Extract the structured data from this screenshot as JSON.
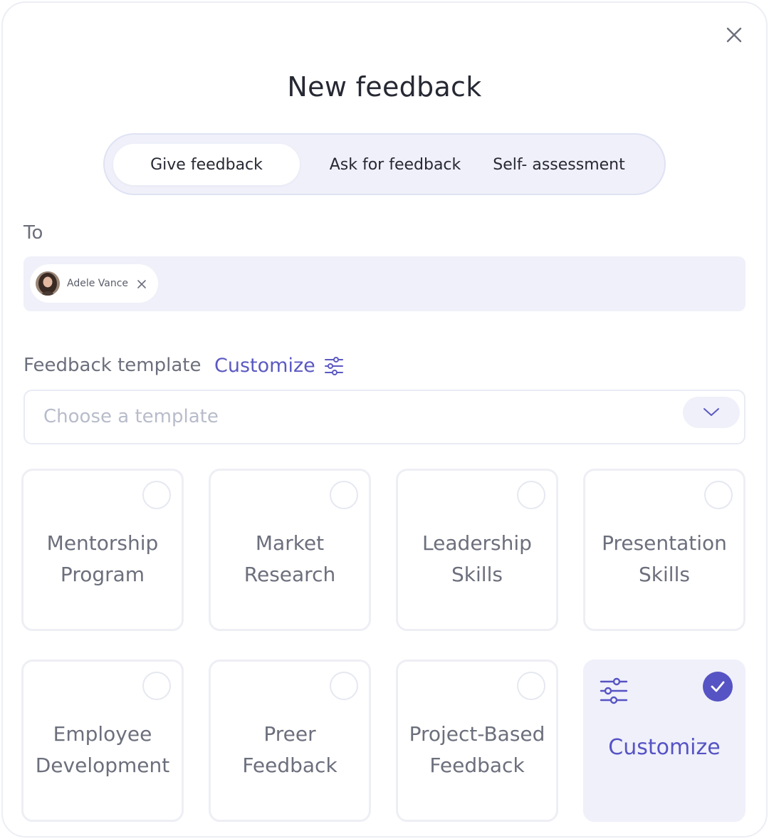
{
  "dialog": {
    "title": "New feedback",
    "close_icon": "close-icon"
  },
  "tabs": [
    {
      "label": "Give feedback",
      "active": true
    },
    {
      "label": "Ask for feedback",
      "active": false
    },
    {
      "label": "Self- assessment",
      "active": false
    }
  ],
  "to_section": {
    "label": "To",
    "recipient": {
      "name": "Adele Vance",
      "avatar_icon": "avatar",
      "remove_icon": "close-icon"
    }
  },
  "template_section": {
    "label": "Feedback template",
    "customize_label": "Customize",
    "customize_icon": "sliders-icon",
    "select_placeholder": "Choose a template",
    "select_icon": "chevron-down-icon"
  },
  "templates": [
    {
      "label_line1": "Mentorship",
      "label_line2": "Program",
      "selected": false
    },
    {
      "label_line1": "Market",
      "label_line2": "Research",
      "selected": false
    },
    {
      "label_line1": "Leadership",
      "label_line2": "Skills",
      "selected": false
    },
    {
      "label_line1": "Presentation",
      "label_line2": "Skills",
      "selected": false
    },
    {
      "label_line1": "Employee",
      "label_line2": "Development",
      "selected": false
    },
    {
      "label_line1": "Preer",
      "label_line2": "Feedback",
      "selected": false
    },
    {
      "label_line1": "Project-Based",
      "label_line2": "Feedback",
      "selected": false
    },
    {
      "label_line1": "Customize",
      "label_line2": "",
      "selected": true
    }
  ],
  "colors": {
    "accent": "#5653c4",
    "surface": "#eff0f9",
    "text_primary": "#262833",
    "text_secondary": "#6c6f7c",
    "placeholder": "#b8bcca"
  }
}
